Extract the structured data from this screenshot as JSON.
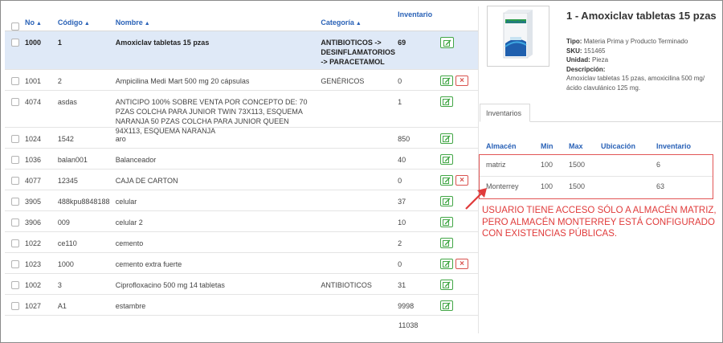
{
  "table": {
    "headers": {
      "no": "No",
      "codigo": "Código",
      "nombre": "Nombre",
      "categoria": "Categoría",
      "inventario": "Inventario"
    },
    "rows": [
      {
        "no": "1000",
        "codigo": "1",
        "nombre": "Amoxiclav tabletas 15 pzas",
        "categoria": "ANTIBIOTICOS -> DESINFLAMATORIOS -> PARACETAMOL",
        "inventario": "69",
        "selected": true,
        "delete": false
      },
      {
        "no": "1001",
        "codigo": "2",
        "nombre": "Ampicilina Medi Mart 500 mg 20 cápsulas",
        "categoria": "GENÉRICOS",
        "inventario": "0",
        "selected": false,
        "delete": true
      },
      {
        "no": "4074",
        "codigo": "asdas",
        "nombre": "ANTICIPO 100% SOBRE VENTA POR CONCEPTO DE: 70 PZAS COLCHA PARA JUNIOR TWIN 73X113, ESQUEMA NARANJA 50 PZAS COLCHA PARA JUNIOR QUEEN 94X113, ESQUEMA NARANJA",
        "categoria": "",
        "inventario": "1",
        "selected": false,
        "delete": false
      },
      {
        "no": "1024",
        "codigo": "1542",
        "nombre": "aro",
        "categoria": "",
        "inventario": "850",
        "selected": false,
        "delete": false
      },
      {
        "no": "1036",
        "codigo": "balan001",
        "nombre": "Balanceador",
        "categoria": "",
        "inventario": "40",
        "selected": false,
        "delete": false
      },
      {
        "no": "4077",
        "codigo": "12345",
        "nombre": "CAJA DE CARTON",
        "categoria": "",
        "inventario": "0",
        "selected": false,
        "delete": true
      },
      {
        "no": "3905",
        "codigo": "488kpu8848188",
        "nombre": "celular",
        "categoria": "",
        "inventario": "37",
        "selected": false,
        "delete": false
      },
      {
        "no": "3906",
        "codigo": "009",
        "nombre": "celular 2",
        "categoria": "",
        "inventario": "10",
        "selected": false,
        "delete": false
      },
      {
        "no": "1022",
        "codigo": "ce110",
        "nombre": "cemento",
        "categoria": "",
        "inventario": "2",
        "selected": false,
        "delete": false
      },
      {
        "no": "1023",
        "codigo": "1000",
        "nombre": "cemento extra fuerte",
        "categoria": "",
        "inventario": "0",
        "selected": false,
        "delete": true
      },
      {
        "no": "1002",
        "codigo": "3",
        "nombre": "Ciprofloxacino 500 mg 14 tabletas",
        "categoria": "ANTIBIOTICOS",
        "inventario": "31",
        "selected": false,
        "delete": false
      },
      {
        "no": "1027",
        "codigo": "A1",
        "nombre": "estambre",
        "categoria": "",
        "inventario": "9998",
        "selected": false,
        "delete": false
      }
    ],
    "total": "11038"
  },
  "detail": {
    "title": "1 - Amoxiclav tabletas 15 pzas",
    "tipo_label": "Tipo:",
    "tipo": "Materia Prima y Producto Terminado",
    "sku_label": "SKU:",
    "sku": "151465",
    "unidad_label": "Unidad:",
    "unidad": "Pieza",
    "descripcion_label": "Descripción:",
    "descripcion": "Amoxiclav tabletas 15 pzas, amoxicilina 500 mg/ácido clavulánico 125 mg.",
    "thumb_brand": "Amoxiclav"
  },
  "inventarios": {
    "tab_label": "Inventarios",
    "headers": {
      "almacen": "Almacén",
      "min": "Min",
      "max": "Max",
      "ubicacion": "Ubicación",
      "inventario": "Inventario"
    },
    "rows": [
      {
        "almacen": "matriz",
        "min": "100",
        "max": "1500",
        "ubicacion": "",
        "inventario": "6"
      },
      {
        "almacen": "Monterrey",
        "min": "100",
        "max": "1500",
        "ubicacion": "",
        "inventario": "63"
      }
    ]
  },
  "annotation": {
    "text": "USUARIO TIENE ACCESO SÓLO A ALMACÉN MATRIZ, PERO ALMACÉN MONTERREY ESTÁ CONFIGURADO CON EXISTENCIAS PÚBLICAS.",
    "color": "#e03b3b"
  },
  "colors": {
    "accent": "#2a62b7",
    "selected_row": "#dfe9f7",
    "edit_button": "#41a645",
    "delete_button": "#d9534f"
  }
}
